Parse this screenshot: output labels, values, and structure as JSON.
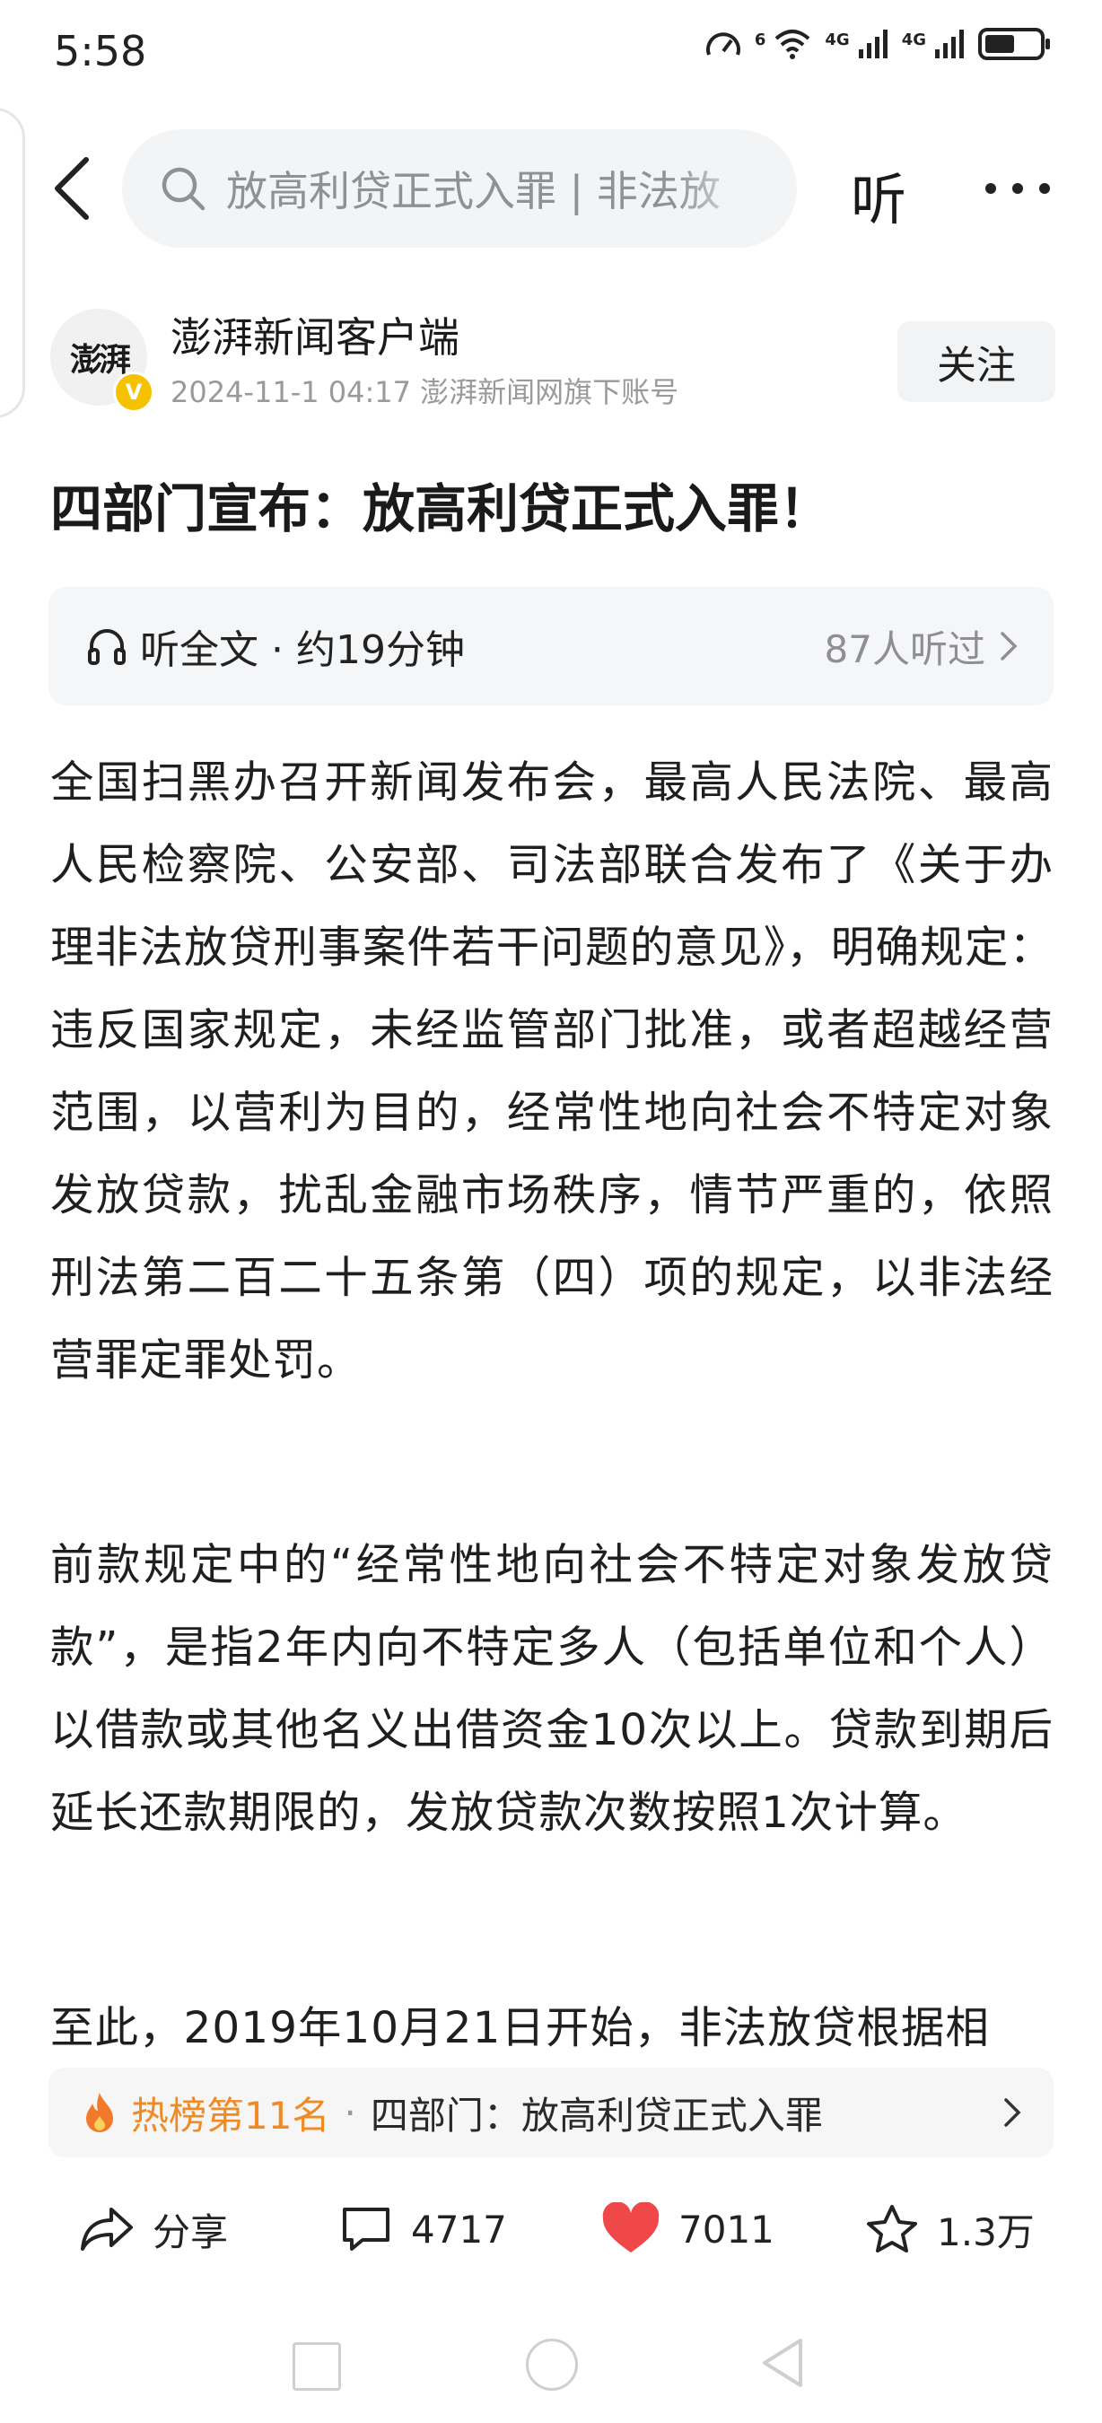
{
  "status_bar": {
    "time": "5:58",
    "wifi_label": "6",
    "signal_1_label": "4G",
    "signal_2_label": "4G"
  },
  "top_nav": {
    "search_text": "放高利贷正式入罪 | 非法放",
    "listen_label": "听"
  },
  "author": {
    "avatar_text": "澎湃",
    "verified_mark": "V",
    "name": "澎湃新闻客户端",
    "meta": "2024-11-1   04:17   澎湃新闻网旗下账号",
    "follow_label": "关注"
  },
  "article": {
    "title": "四部门宣布：放高利贷正式入罪！",
    "listen_bar": {
      "label": "听全文 · 约19分钟",
      "count": "87人听过"
    },
    "paragraphs": [
      "全国扫黑办召开新闻发布会，最高人民法院、最高人民检察院、公安部、司法部联合发布了《关于办理非法放贷刑事案件若干问题的意见》，明确规定：违反国家规定，未经监管部门批准，或者超越经营范围，以营利为目的，经常性地向社会不特定对象发放贷款，扰乱金融市场秩序，情节严重的，依照刑法第二百二十五条第（四）项的规定，以非法经营罪定罪处罚。",
      "前款规定中的“经常性地向社会不特定对象发放贷款”，是指2年内向不特定多人（包括单位和个人）以借款或其他名义出借资金10次以上。贷款到期后延长还款期限的，发放贷款次数按照1次计算。",
      "至此，2019年10月21日开始，非法放贷根据相"
    ]
  },
  "hot_rank": {
    "rank": "热榜第11名",
    "separator": "·",
    "title": "四部门：放高利贷正式入罪"
  },
  "actions": {
    "share": "分享",
    "comments": "4717",
    "likes": "7011",
    "favorites": "1.3万"
  },
  "colors": {
    "accent_orange": "#f08a24",
    "like_red": "#f04848",
    "verified_yellow": "#f5c200"
  }
}
